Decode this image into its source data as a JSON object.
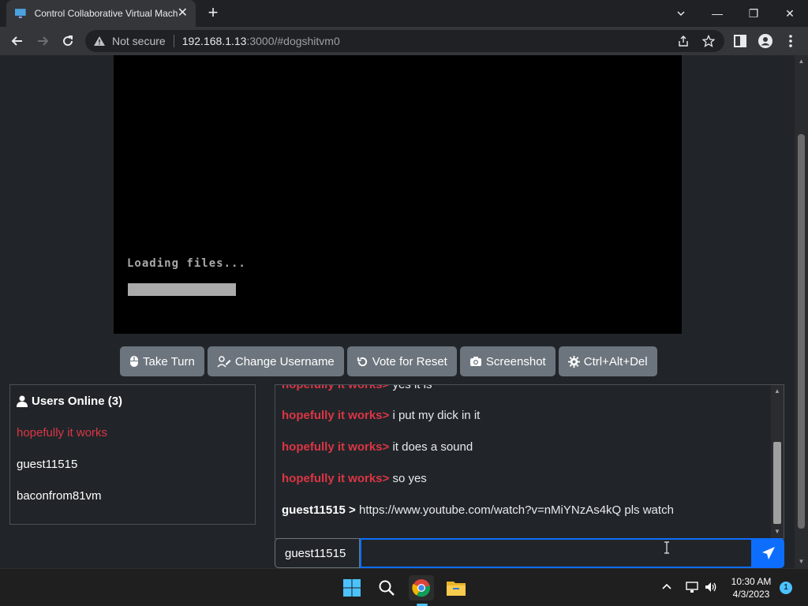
{
  "browser": {
    "tab_title": "Control Collaborative Virtual Machine",
    "tab_close": "✕",
    "new_tab": "+",
    "window_controls": {
      "minimize": "—",
      "restore": "❐",
      "close": "✕"
    },
    "omnibox": {
      "security_label": "Not secure",
      "host": "192.168.1.13",
      "path": ":3000/#dogshitvm0"
    }
  },
  "vm": {
    "loading_text": "Loading files...",
    "loading_progress": 0.19
  },
  "controls": {
    "take_turn": "Take Turn",
    "change_username": "Change Username",
    "vote_reset": "Vote for Reset",
    "screenshot": "Screenshot",
    "ctrl_alt_del": "Ctrl+Alt+Del"
  },
  "users": {
    "heading": "Users Online (3)",
    "list": [
      {
        "name": "hopefully it works",
        "color": "#dc3545"
      },
      {
        "name": "guest11515",
        "color": "#ffffff"
      },
      {
        "name": "baconfrom81vm",
        "color": "#ffffff"
      }
    ]
  },
  "chat": {
    "messages": [
      {
        "user": "hopefully it works>",
        "text": "yes it is"
      },
      {
        "user": "hopefully it works>",
        "text": "i put my dick in it"
      },
      {
        "user": "hopefully it works>",
        "text": "it does a sound"
      },
      {
        "user": "hopefully it works>",
        "text": "so yes"
      },
      {
        "user": "guest11515 >",
        "text": "https://www.youtube.com/watch?v=nMiYNzAs4kQ pls watch"
      }
    ],
    "username_label": "guest11515",
    "input_value": "",
    "input_placeholder": ""
  },
  "taskbar": {
    "time": "10:30 AM",
    "date": "4/3/2023",
    "notification_count": "1"
  },
  "colors": {
    "accent": "#0d6efd",
    "admin_red": "#dc3545",
    "button_grey": "#6c757d"
  }
}
